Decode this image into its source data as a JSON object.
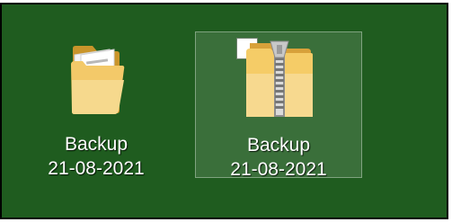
{
  "desktop": {
    "items": [
      {
        "icon": "documents-folder-icon",
        "name_line_1": "Backup",
        "name_line_2": "21-08-2021",
        "selected": false
      },
      {
        "icon": "zip-folder-icon",
        "name_line_1": "Backup",
        "name_line_2": "21-08-2021",
        "selected": true
      }
    ]
  },
  "colors": {
    "desktop_background": "#1f5c1f",
    "selection_border": "#7fa37f",
    "label_text": "#ffffff"
  }
}
